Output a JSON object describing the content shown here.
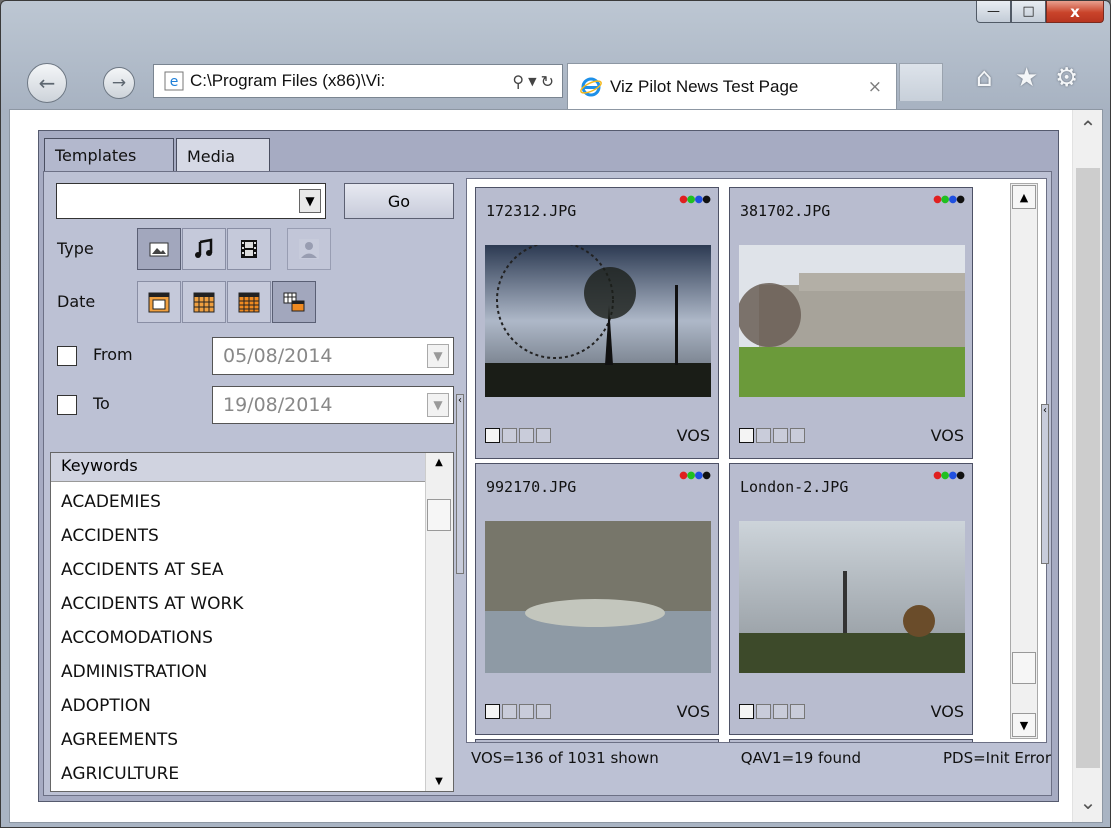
{
  "browser": {
    "address": "C:\\Program Files (x86)\\Vi:",
    "tab_title": "Viz Pilot News Test Page",
    "tab_close": "×",
    "caption": {
      "minimize": "—",
      "maximize": "□",
      "close": "x"
    }
  },
  "app": {
    "tabs": [
      {
        "label": "Templates",
        "selected": false
      },
      {
        "label": "Media",
        "selected": true
      }
    ],
    "search": {
      "value": "",
      "go_label": "Go"
    },
    "type_label": "Type",
    "type_icons": [
      "image-icon",
      "music-note-icon",
      "film-icon",
      "person-icon"
    ],
    "date_label": "Date",
    "date_icons": [
      "calendar-day-icon",
      "calendar-week-icon",
      "calendar-month-icon",
      "calendar-range-icon"
    ],
    "from": {
      "label": "From",
      "value": "05/08/2014",
      "checked": false
    },
    "to": {
      "label": "To",
      "value": "19/08/2014",
      "checked": false
    },
    "keywords": {
      "header": "Keywords",
      "items": [
        "ACADEMIES",
        "ACCIDENTS",
        "ACCIDENTS AT SEA",
        "ACCIDENTS AT WORK",
        "ACCOMODATIONS",
        "ADMINISTRATION",
        "ADOPTION",
        "AGREEMENTS",
        "AGRICULTURE"
      ]
    },
    "media": [
      {
        "filename": "172312.JPG",
        "source": "VOS"
      },
      {
        "filename": "381702.JPG",
        "source": "VOS"
      },
      {
        "filename": "992170.JPG",
        "source": "VOS"
      },
      {
        "filename": "London-2.JPG",
        "source": "VOS"
      }
    ],
    "status": {
      "vos": "VOS=136 of 1031 shown",
      "qav": "QAV1=19 found",
      "pds": "PDS=Init Error"
    },
    "colors": {
      "panel": "#bcc1d4",
      "card": "#b8bccf",
      "dot_red": "#e02020",
      "dot_green": "#20c020",
      "dot_blue": "#2050e0"
    }
  }
}
